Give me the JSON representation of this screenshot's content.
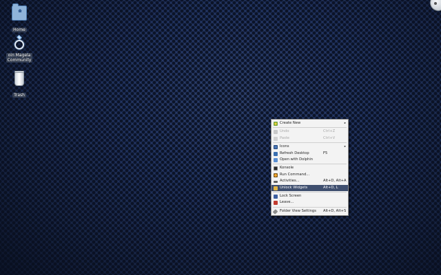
{
  "desktop": {
    "icons": [
      {
        "label": "Home",
        "icon": "home-folder-icon"
      },
      {
        "label_lines": [
          "oin Magela",
          "Community"
        ],
        "icon": "ring-icon"
      },
      {
        "label": "Trash",
        "icon": "trash-icon"
      }
    ]
  },
  "context_menu": {
    "items": [
      {
        "label": "Create New",
        "icon": "create-new-icon",
        "submenu": true
      },
      {
        "label": "Undo",
        "shortcut": "Ctrl+Z",
        "icon": "undo-icon",
        "disabled": true
      },
      {
        "label": "Paste",
        "shortcut": "Ctrl+V",
        "icon": "paste-icon",
        "disabled": true
      },
      {
        "label": "Icons",
        "icon": "icons-icon",
        "submenu": true
      },
      {
        "label": "Refresh Desktop",
        "shortcut": "F5",
        "icon": "refresh-icon"
      },
      {
        "label": "Open with Dolphin",
        "icon": "dolphin-icon"
      },
      {
        "label": "Konsole",
        "icon": "konsole-icon"
      },
      {
        "label": "Run Command...",
        "icon": "run-command-icon"
      },
      {
        "label": "Activities...",
        "shortcut": "Alt+D, Alt+A",
        "icon": "activities-icon"
      },
      {
        "label": "Unlock Widgets",
        "shortcut": "Alt+D, L",
        "icon": "lock-widgets-icon",
        "selected": true
      },
      {
        "label": "Lock Screen",
        "icon": "lock-screen-icon"
      },
      {
        "label": "Leave...",
        "icon": "leave-icon"
      },
      {
        "label": "Folder View Settings",
        "shortcut": "Alt+D, Alt+S",
        "icon": "settings-icon"
      }
    ]
  },
  "colors": {
    "menu_highlight": "#3f4f6f",
    "menu_background": "#f3f3f3",
    "desktop_base": "#1b2a4c"
  }
}
